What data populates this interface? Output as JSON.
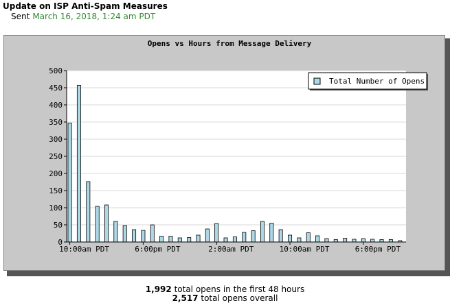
{
  "message": {
    "title": "Update on ISP Anti-Spam Measures",
    "sent_label": "Sent",
    "sent_date": "March 16, 2018, 1:24 am PDT"
  },
  "chart_data": {
    "type": "bar",
    "title": "Opens vs Hours from Message Delivery",
    "legend": [
      "Total Number of Opens"
    ],
    "legend_position": "top-right",
    "ylim": [
      0,
      500
    ],
    "yticks": [
      0,
      50,
      100,
      150,
      200,
      250,
      300,
      350,
      400,
      450,
      500
    ],
    "grid": true,
    "colors": {
      "bar": "#add8e6",
      "bar_stroke": "#000000",
      "plot_bg": "#ffffff",
      "frame_bg": "#c8c8c8"
    },
    "x_labels": [
      {
        "label": "10:00am PDT",
        "index": 0
      },
      {
        "label": "6:00pm PDT",
        "index": 8
      },
      {
        "label": "2:00am PDT",
        "index": 16
      },
      {
        "label": "10:00am PDT",
        "index": 24
      },
      {
        "label": "6:00pm PDT",
        "index": 32
      }
    ],
    "values": [
      347,
      457,
      176,
      104,
      108,
      60,
      48,
      36,
      34,
      50,
      17,
      17,
      12,
      13,
      20,
      38,
      54,
      12,
      15,
      28,
      33,
      60,
      55,
      36,
      20,
      12,
      27,
      18,
      10,
      7,
      11,
      8,
      10,
      8,
      7,
      7,
      4
    ]
  },
  "summary": {
    "first48_count": "1,992",
    "first48_text": "total opens in the first 48 hours",
    "overall_count": "2,517",
    "overall_text": "total opens overall"
  }
}
